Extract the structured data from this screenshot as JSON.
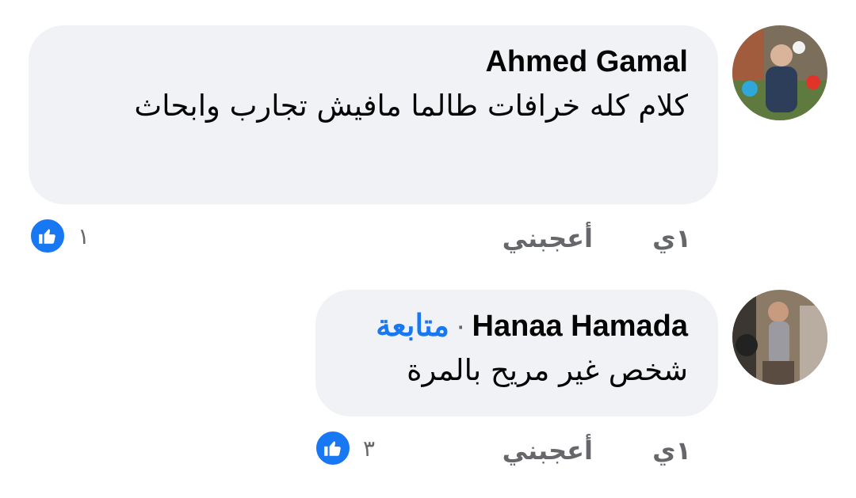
{
  "comments": [
    {
      "author": "Ahmed Gamal",
      "text": "كلام كله خرافات طالما مافيش تجارب وابحاث",
      "time": "١ي",
      "like_label": "أعجبني",
      "reaction_count": "١"
    },
    {
      "author": "Hanaa Hamada",
      "follow_label": "متابعة",
      "separator": "·",
      "text": "شخص غير مريح بالمرة",
      "time": "١ي",
      "like_label": "أعجبني",
      "reaction_count": "٣"
    }
  ],
  "colors": {
    "bubble": "#f0f2f5",
    "link": "#1877f2",
    "meta": "#65676b",
    "text": "#050505"
  },
  "icons": {
    "reaction": "thumbs-up-icon"
  }
}
